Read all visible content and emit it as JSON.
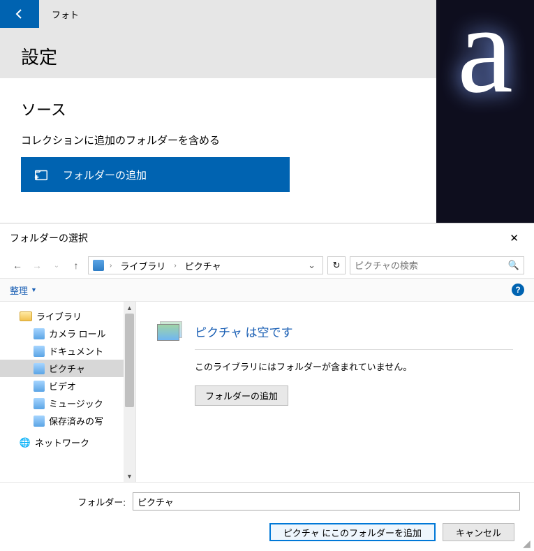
{
  "photos": {
    "app_name": "フォト",
    "page_title": "設定",
    "source_heading": "ソース",
    "source_sub": "コレクションに追加のフォルダーを含める",
    "add_folder_label": "フォルダーの追加"
  },
  "dialog": {
    "title": "フォルダーの選択",
    "breadcrumb": {
      "root": "ライブラリ",
      "current": "ピクチャ"
    },
    "search_placeholder": "ピクチャの検索",
    "organize_label": "整理",
    "tree": {
      "libraries": "ライブラリ",
      "items": [
        {
          "label": "カメラ ロール",
          "icon": "blue"
        },
        {
          "label": "ドキュメント",
          "icon": "blue"
        },
        {
          "label": "ピクチャ",
          "icon": "blue",
          "selected": true
        },
        {
          "label": "ビデオ",
          "icon": "blue"
        },
        {
          "label": "ミュージック",
          "icon": "blue"
        },
        {
          "label": "保存済みの写",
          "icon": "blue"
        }
      ],
      "network": "ネットワーク"
    },
    "empty": {
      "title": "ピクチャ は空です",
      "message": "このライブラリにはフォルダーが含まれていません。",
      "add_btn": "フォルダーの追加"
    },
    "footer": {
      "folder_label": "フォルダー:",
      "folder_value": "ピクチャ",
      "ok_label": "ピクチャ にこのフォルダーを追加",
      "cancel_label": "キャンセル"
    }
  }
}
